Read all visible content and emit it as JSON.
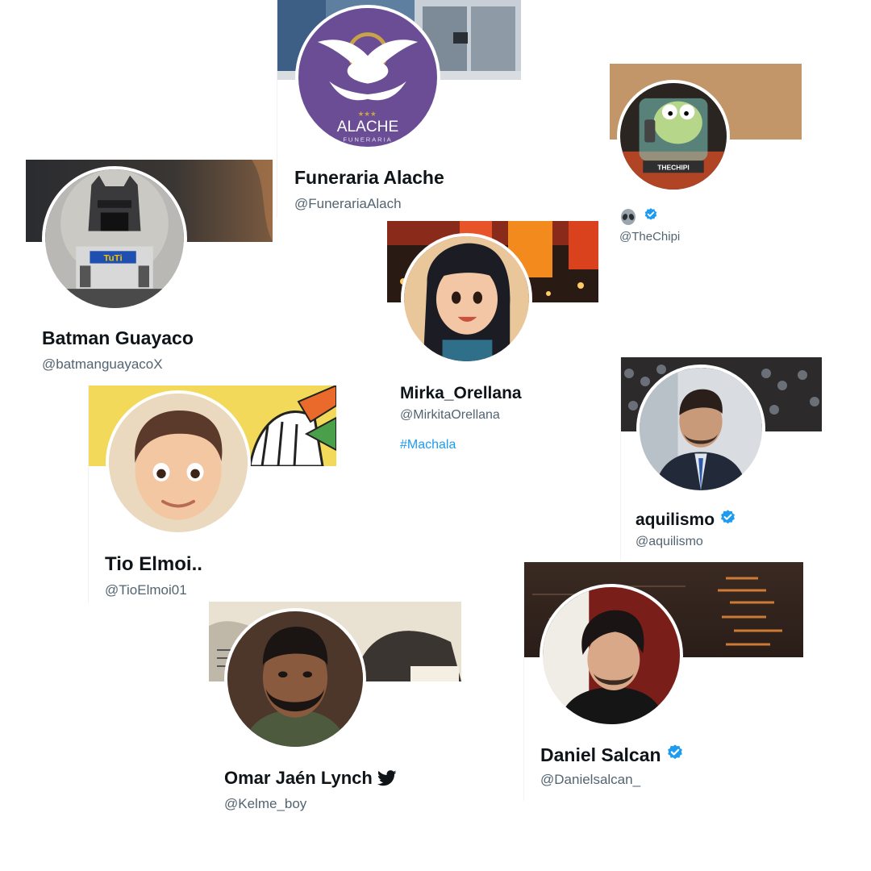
{
  "colors": {
    "verified": "#1d9bf0",
    "name": "#0f1419",
    "handle": "#536471",
    "hashtag": "#1d9bf0"
  },
  "profiles": [
    {
      "name": "Funeraria Alache",
      "handle": "@FunerariaAlach",
      "avatar_text": "ALACHE",
      "avatar_subtext": "FUNERARIA",
      "verified": false
    },
    {
      "name": "",
      "name_icon": "alien-emoji-icon",
      "handle": "@TheChipi",
      "avatar_text": "THECHIPI",
      "verified": true
    },
    {
      "name": "Batman Guayaco",
      "handle": "@batmanguayacoX",
      "avatar_text": "TuTi",
      "verified": false
    },
    {
      "name": "Mirka_Orellana",
      "handle": "@MirkitaOrellana",
      "hashtag": "#Machala",
      "verified": false
    },
    {
      "name": "Tio Elmoi..",
      "handle": "@TioElmoi01",
      "verified": false
    },
    {
      "name": "aquilismo",
      "handle": "@aquilismo",
      "verified": true
    },
    {
      "name": "Omar Jaén Lynch",
      "name_icon": "twitter-bird-icon",
      "handle": "@Kelme_boy",
      "verified": false
    },
    {
      "name": "Daniel Salcan",
      "handle": "@Danielsalcan_",
      "verified": true
    }
  ]
}
